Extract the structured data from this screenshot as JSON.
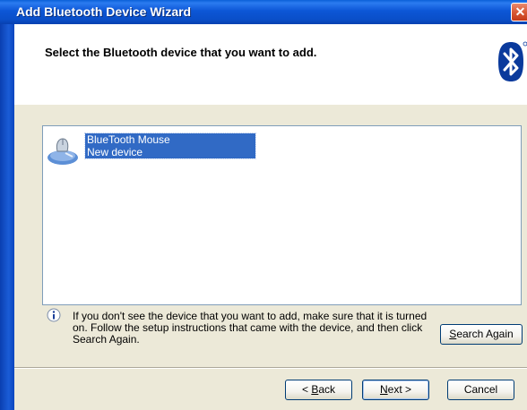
{
  "window": {
    "title": "Add Bluetooth Device Wizard",
    "close_glyph": "✕"
  },
  "header": {
    "heading": "Select the Bluetooth device that you want to add.",
    "logo_icon": "bluetooth-icon"
  },
  "device_list": {
    "items": [
      {
        "name": "BlueTooth Mouse",
        "status": "New device",
        "icon": "bluetooth-mouse-icon",
        "selected": true
      }
    ]
  },
  "info": {
    "icon": "info-icon",
    "text": "If you don't see the device that you want to add, make sure that it is turned on. Follow the setup instructions that came with the device, and then click Search Again."
  },
  "buttons": {
    "search_again_prefix": "",
    "search_again_mnemonic": "S",
    "search_again_rest": "earch Again",
    "back_prefix": "< ",
    "back_mnemonic": "B",
    "back_rest": "ack",
    "next_mnemonic": "N",
    "next_rest": "ext >",
    "cancel": "Cancel"
  },
  "colors": {
    "titlebar": "#0a4fc9",
    "selection": "#316ac5",
    "dialog_bg": "#ece9d8"
  }
}
